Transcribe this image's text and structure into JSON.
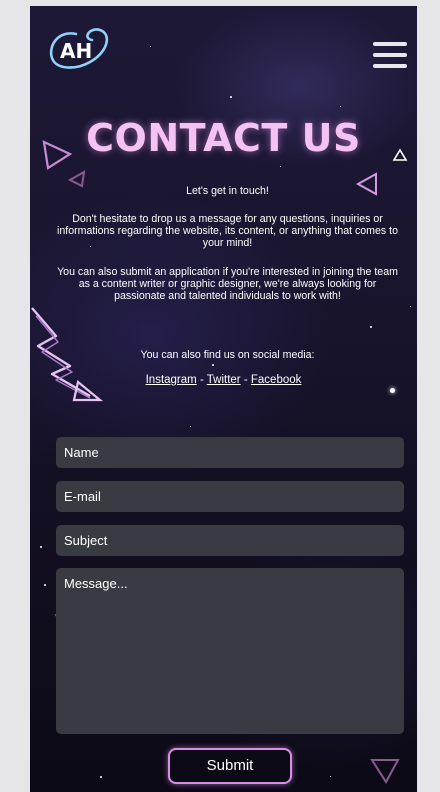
{
  "brand": {
    "logo_text": "AH"
  },
  "header": {
    "menu_icon": "hamburger-icon"
  },
  "page": {
    "title": "CONTACT US"
  },
  "content": {
    "intro": "Let's get in touch!",
    "paragraph_1": "Don't hesitate to drop us a message for any questions, inquiries or informations regarding the website, its content, or anything that comes to your mind!",
    "paragraph_2": "You can also submit an application if you're interested in joining the team as a content writer or graphic designer, we're always looking for passionate and talented individuals to work with!",
    "social_intro": "You can also find us on social media:"
  },
  "social": {
    "instagram": "Instagram",
    "separator_1": " - ",
    "twitter": "Twitter",
    "separator_2": " - ",
    "facebook": "Facebook"
  },
  "form": {
    "name_placeholder": "Name",
    "email_placeholder": "E-mail",
    "subject_placeholder": "Subject",
    "message_placeholder": "Message...",
    "submit_label": "Submit"
  },
  "colors": {
    "title": "#f4c2f3",
    "neon_accent": "#d98ee3",
    "field_bg": "#3a3a42",
    "background": "#141024"
  }
}
